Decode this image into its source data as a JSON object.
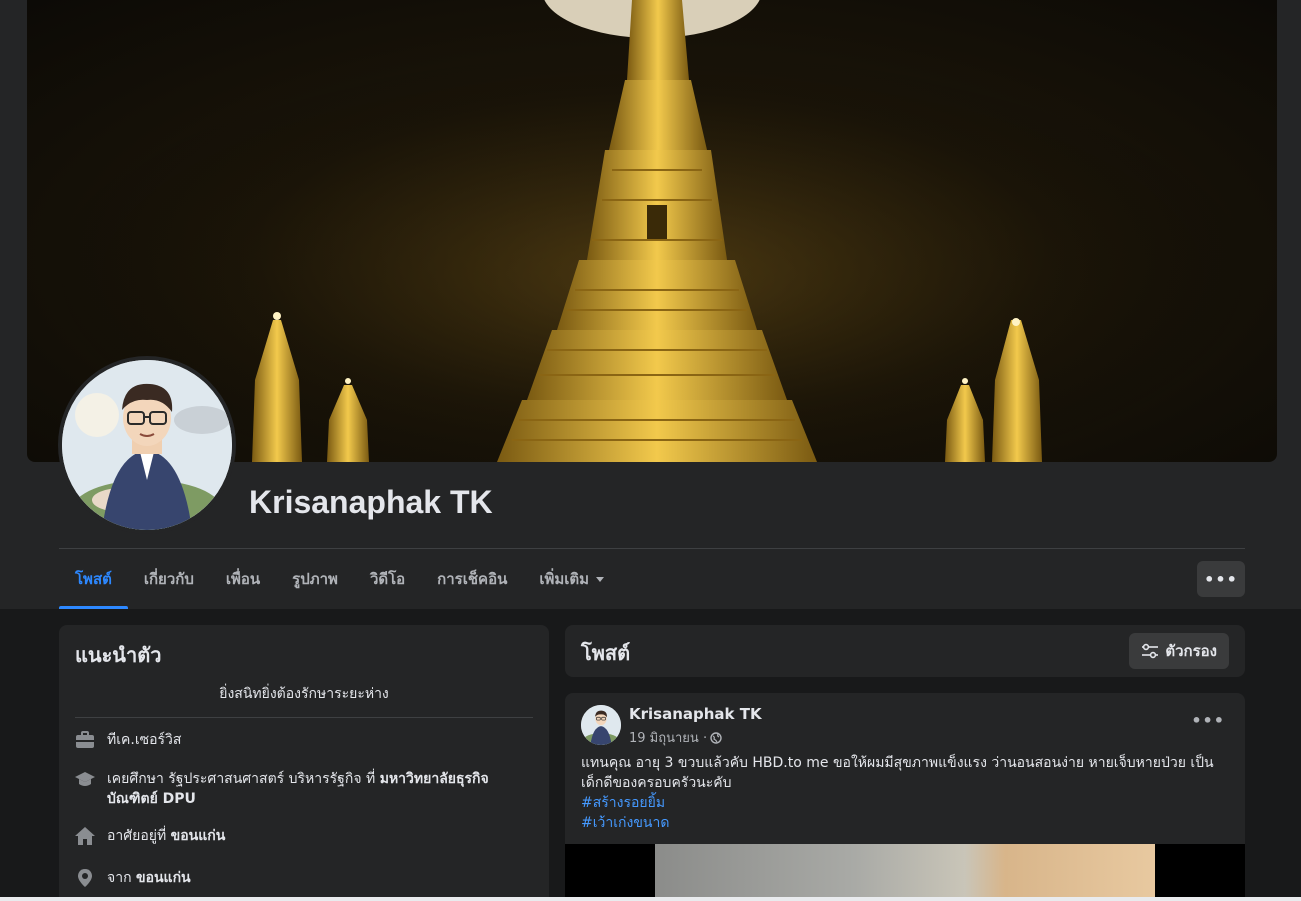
{
  "profile": {
    "name": "Krisanaphak TK"
  },
  "tabs": [
    {
      "label": "โพสต์",
      "active": true
    },
    {
      "label": "เกี่ยวกับ",
      "active": false
    },
    {
      "label": "เพื่อน",
      "active": false
    },
    {
      "label": "รูปภาพ",
      "active": false
    },
    {
      "label": "วิดีโอ",
      "active": false
    },
    {
      "label": "การเช็คอิน",
      "active": false
    },
    {
      "label": "เพิ่มเติม",
      "active": false
    }
  ],
  "more_button": "•••",
  "intro": {
    "title": "แนะนำตัว",
    "bio": "ยิ่งสนิทยิ่งต้องรักษาระยะห่าง",
    "work": "ทีเค.เซอร์วิส",
    "education_prefix": "เคยศึกษา รัฐประศาสนศาสตร์ บริหารรัฐกิจ ที่",
    "education_school": "มหาวิทยาลัยธุรกิจบัณฑิตย์ DPU",
    "lives_prefix": "อาศัยอยู่ที่",
    "lives_place": "ขอนแก่น",
    "from_prefix": "จาก",
    "from_place": "ขอนแก่น"
  },
  "posts_section": {
    "title": "โพสต์",
    "filter_label": "ตัวกรอง"
  },
  "post": {
    "author": "Krisanaphak TK",
    "date": "19 มิถุนายน ·",
    "dots": "•••",
    "text": "แทนคุณ อายุ 3 ขวบแล้วคับ HBD.to me ขอให้ผมมีสุขภาพแข็งแรง ว่านอนสอนง่าย หายเจ็บหายป่วย เป็นเด็กดีของครอบครัวนะคับ",
    "hashtags": [
      "#สร้างรอยยิ้ม",
      "#เว้าเก่งขนาด"
    ]
  },
  "colors": {
    "accent": "#2d88ff",
    "hashtag": "#4599ff",
    "card_bg": "#242526",
    "page_bg": "#18191a"
  },
  "icons": {
    "work": "briefcase-icon",
    "education": "graduation-cap-icon",
    "home": "home-icon",
    "location": "location-pin-icon",
    "privacy": "globe-icon",
    "filter": "sliders-icon"
  }
}
